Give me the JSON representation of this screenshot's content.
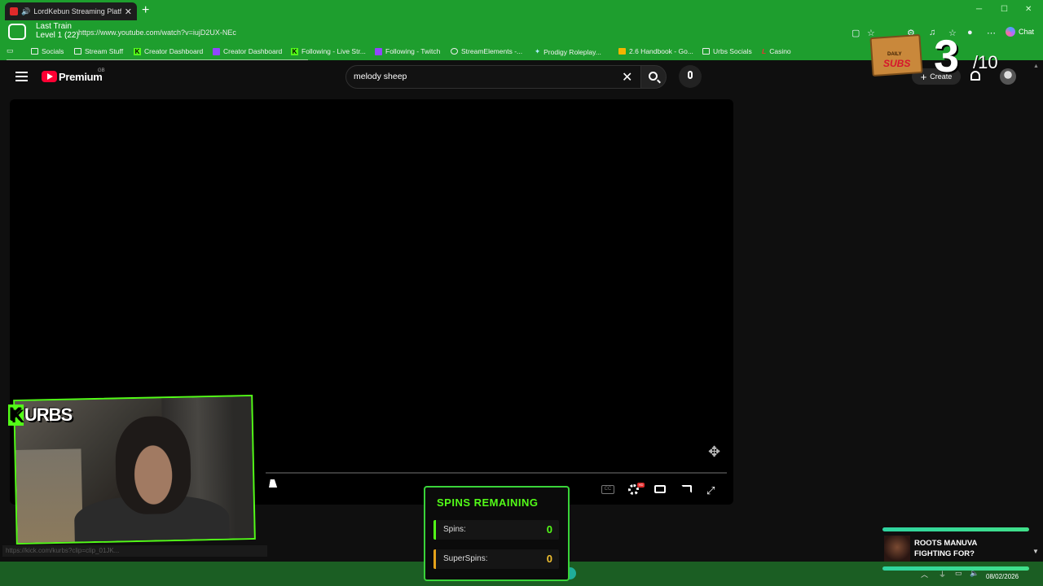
{
  "browser": {
    "tab_title": "LordKebun Streaming Platform",
    "url": "https://www.youtube.com/watch?v=iujD2UX-NEc",
    "chat_label": "Chat",
    "bookmarks": [
      {
        "label": "Socials",
        "icon": "folder-icon"
      },
      {
        "label": "Stream Stuff",
        "icon": "folder-icon"
      },
      {
        "label": "Creator Dashboard",
        "icon": "kick-icon"
      },
      {
        "label": "Creator Dashboard",
        "icon": "twitch-icon"
      },
      {
        "label": "Following - Live Str...",
        "icon": "kick-icon"
      },
      {
        "label": "Following - Twitch",
        "icon": "twitch-icon"
      },
      {
        "label": "StreamElements -...",
        "icon": "streamelements-icon"
      },
      {
        "label": "Prodigy Roleplay...",
        "icon": "prodigy-icon"
      },
      {
        "label": "2.6 Handbook - Go...",
        "icon": "doc-icon"
      },
      {
        "label": "Urbs Socials",
        "icon": "folder-icon"
      },
      {
        "label": "Casino",
        "icon": "casino-icon"
      }
    ]
  },
  "overlay_train": {
    "title": "Last Train",
    "level": "Level 1  (22)"
  },
  "youtube": {
    "brand": "Premium",
    "region": "GB",
    "search_value": "melody sheep",
    "create_label": "Create"
  },
  "daily_subs": {
    "box_line1": "DAILY",
    "box_line2": "SUBS",
    "count": "3",
    "goal": "/10"
  },
  "webcam": {
    "channel_logo": "URBS",
    "logo_letter": "K"
  },
  "status_url": "https://kick.com/kurbs?clip=clip_01JK...",
  "spins": {
    "title": "SPINS REMAINING",
    "rows": [
      {
        "label": "Spins:",
        "value": "0"
      },
      {
        "label": "SuperSpins:",
        "value": "0"
      }
    ]
  },
  "now_playing": {
    "artist": "ROOTS MANUVA",
    "track": "FIGHTING FOR?"
  },
  "taskbar": {
    "date": "08/02/2026"
  },
  "colors": {
    "chrome_green": "#1e9e2e",
    "kick_green": "#53fc18",
    "youtube_red": "#ff0033"
  }
}
